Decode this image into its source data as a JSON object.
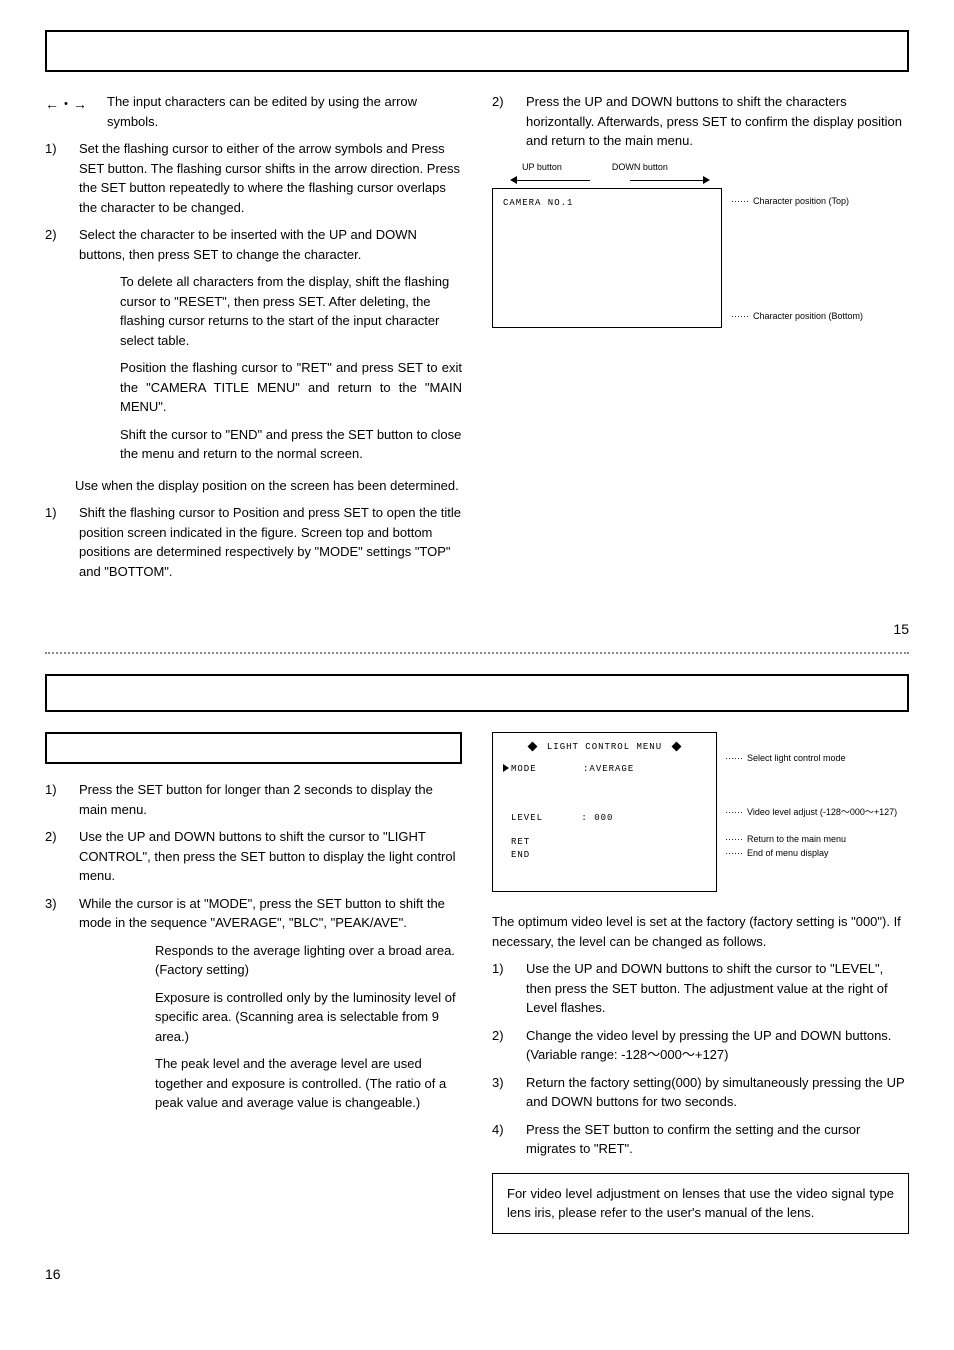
{
  "section1": {
    "arrows_symbol": "←・→",
    "arrows_text": "The input characters can be edited by using the arrow symbols.",
    "step1_num": "1)",
    "step1": "Set the flashing cursor to either of the arrow symbols and Press SET button. The flashing cursor shifts in the arrow direction. Press the SET button repeatedly to where the flashing cursor overlaps the character to be changed.",
    "step2_num": "2)",
    "step2": "Select the character to be inserted with the UP and DOWN buttons, then press SET to change the character.",
    "indent1": "To delete all characters from the display, shift the flashing cursor to \"RESET\", then press SET. After deleting, the flashing cursor returns to the start of the input character select table.",
    "indent2": "Position the flashing cursor to \"RET\" and press SET to exit the \"CAMERA TITLE MENU\" and return to the \"MAIN MENU\".",
    "indent3": "Shift the cursor to \"END\" and press the SET button to close the menu and return to the normal screen.",
    "para1": "Use when the display position on the screen has been determined.",
    "pos1_num": "1)",
    "pos1": "Shift the flashing cursor to Position and press SET to open the title position screen indicated in the figure. Screen top and bottom positions are determined respectively by \"MODE\" settings \"TOP\" and \"BOTTOM\".",
    "right_step2_num": "2)",
    "right_step2": "Press the UP and DOWN buttons to shift the characters horizontally. Afterwards, press SET to confirm the display position and return to the main menu.",
    "fig_up": "UP button",
    "fig_down": "DOWN button",
    "fig_camera": "CAMERA NO.1",
    "fig_top_label": "Character position (Top)",
    "fig_bottom_label": "Character position (Bottom)",
    "page_num": "15"
  },
  "section2": {
    "left": {
      "s1_num": "1)",
      "s1": "Press the SET button for longer than 2 seconds to display the main menu.",
      "s2_num": "2)",
      "s2": "Use the UP and DOWN buttons to shift the cursor to \"LIGHT CONTROL\", then press the SET button to display the light control menu.",
      "s3_num": "3)",
      "s3": "While the cursor is at \"MODE\", press the SET button to shift the mode in the sequence \"AVERAGE\", \"BLC\", \"PEAK/AVE\".",
      "mode1": "Responds to the average lighting over a broad area. (Factory setting)",
      "mode2": "Exposure is controlled only by the luminosity level of specific area. (Scanning area is selectable from 9 area.)",
      "mode3": "The peak level and the average level are used together and exposure is controlled. (The ratio of a peak value and average value is changeable.)"
    },
    "menu": {
      "title": "LIGHT CONTROL MENU",
      "mode_label": "MODE",
      "mode_value": ":AVERAGE",
      "level_label": "LEVEL",
      "level_value": ": 000",
      "ret": "RET",
      "end": "END",
      "annot1": "Select light control mode",
      "annot2": "Video level adjust (-128～000～+127)",
      "annot3": "Return to the main menu",
      "annot4": "End of menu display"
    },
    "right": {
      "intro": "The optimum video level is set at the factory (factory setting is \"000\"). If necessary, the level can be changed as follows.",
      "s1_num": "1)",
      "s1": "Use the UP and DOWN buttons to shift the cursor to \"LEVEL\", then press the SET button. The adjustment value at the right of Level flashes.",
      "s2_num": "2)",
      "s2": "Change the video level by pressing the UP and DOWN buttons. (Variable range: -128～000～+127)",
      "s3_num": "3)",
      "s3": "Return the factory setting(000) by simultaneously pressing the UP and DOWN buttons for two seconds.",
      "s4_num": "4)",
      "s4": "Press the SET button to confirm the setting and the cursor migrates to \"RET\".",
      "note": "For video level adjustment on lenses that use the video signal type lens iris, please refer to the user's manual of the lens."
    },
    "page_num": "16"
  }
}
